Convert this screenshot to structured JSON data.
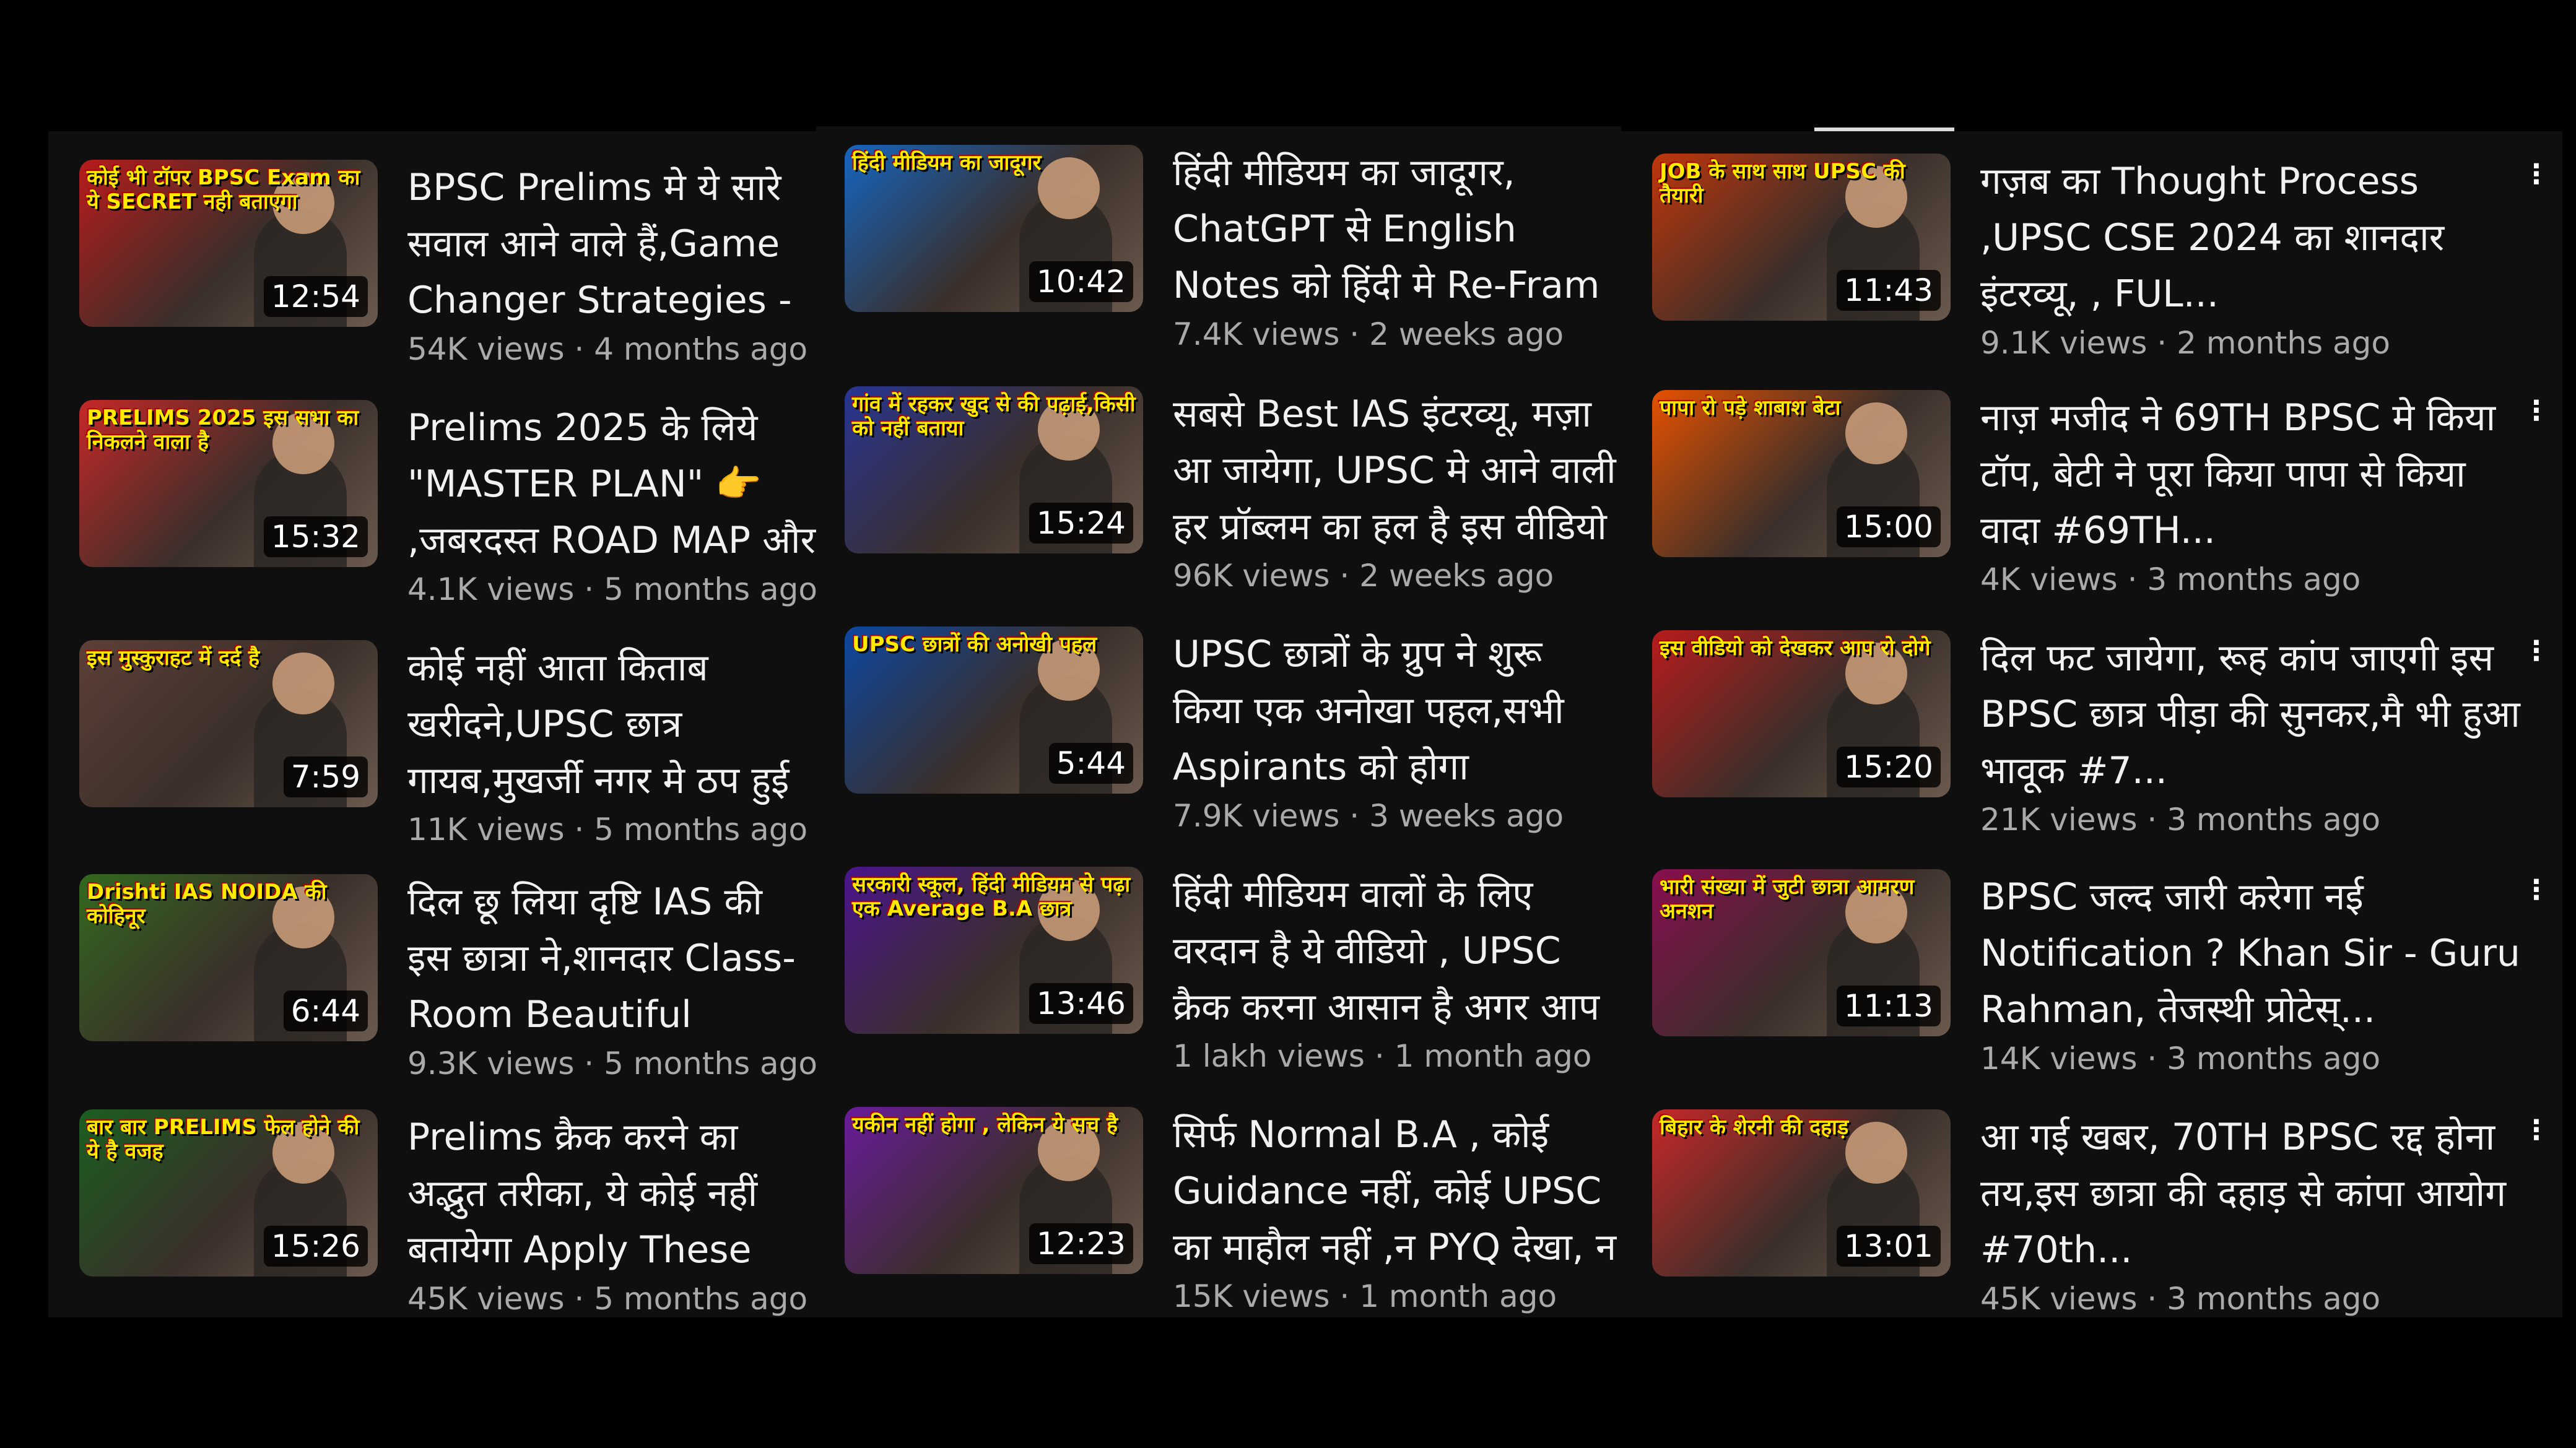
{
  "columns": [
    {
      "items": [
        {
          "title": "BPSC Prelims मे ये सारे सवाल आने वाले हैं,Game Changer Strategies -Topper's Secret",
          "views": "54K views",
          "age": "4 months ago",
          "duration": "12:54",
          "thumb_caption": "कोई भी टॉपर BPSC Exam का ये SECRET नही बताएगा",
          "accent": "#b71c1c"
        },
        {
          "title": "Prelims 2025 के लिये \"MASTER PLAN\" 👉 ,जबरदस्त ROAD MAP और Time Table",
          "views": "4.1K views",
          "age": "5 months ago",
          "duration": "15:32",
          "thumb_caption": "PRELIMS 2025 इस सभा का निकलने वाला है",
          "accent": "#c62828"
        },
        {
          "title": "कोई नहीं आता किताब खरीदने,UPSC छात्र गायब,मुखर्जी नगर मे ठप हुई सारी Business",
          "views": "11K views",
          "age": "5 months ago",
          "duration": "7:59",
          "thumb_caption": "इस मुस्कुराहट में दर्द है",
          "accent": "#5d4037"
        },
        {
          "title": "दिल छू लिया दृष्टि IAS की इस छात्रा ने,शानदार Class-Room Beautiful legacy, Noida",
          "views": "9.3K views",
          "age": "5 months ago",
          "duration": "6:44",
          "thumb_caption": "Drishti IAS NOIDA की कोहिनूर",
          "accent": "#33691e"
        },
        {
          "title": "Prelims क्रैक करने का अद्भुत तरीका, ये कोई नहीं बतायेगा Apply These Strategies",
          "views": "45K views",
          "age": "5 months ago",
          "duration": "15:26",
          "thumb_caption": "बार बार PRELIMS फेल होने की ये है वजह",
          "accent": "#1b5e20"
        }
      ]
    },
    {
      "items": [
        {
          "title": "हिंदी मीडियम का जादूगर, ChatGPT से English Notes को हिंदी मे Re-Fram करने का नया",
          "views": "7.4K views",
          "age": "2 weeks ago",
          "duration": "10:42",
          "thumb_caption": "हिंदी मीडियम का जादूगर",
          "accent": "#1565c0"
        },
        {
          "title": "सबसे Best IAS इंटरव्यू, मज़ा आ जायेगा, UPSC मे आने वाली हर प्रॉब्लम का हल है इस वीडियो में",
          "views": "96K views",
          "age": "2 weeks ago",
          "duration": "15:24",
          "thumb_caption": "गांव में रहकर खुद से की पढ़ाई,किसी को नहीं बताया",
          "accent": "#283593"
        },
        {
          "title": "UPSC छात्रों के ग्रुप ने शुरू किया एक अनोखा पहल,सभी Aspirants को होगा फ़ायदा,Toppers Notes",
          "views": "7.9K views",
          "age": "3 weeks ago",
          "duration": "5:44",
          "thumb_caption": "UPSC छात्रों की अनोखी पहल",
          "accent": "#0d47a1"
        },
        {
          "title": "हिंदी मीडियम वालों के लिए वरदान है ये वीडियो , UPSC क्रैक करना आसान है अगर आप ये करो #IAS",
          "views": "1 lakh views",
          "age": "1 month ago",
          "duration": "13:46",
          "thumb_caption": "सरकारी स्कूल, हिंदी मीडियम से पढ़ा एक Average B.A छात्र",
          "accent": "#4a148c"
        },
        {
          "title": "सिर्फ Normal B.A , कोई Guidance नहीं, कोई UPSC का माहौल नहीं ,न PYQ देखा, न फिर भी",
          "views": "15K views",
          "age": "1 month ago",
          "duration": "12:23",
          "thumb_caption": "यकीन नहीं होगा , लेकिन ये सच है",
          "accent": "#6a1b9a"
        }
      ]
    },
    {
      "items": [
        {
          "title": "गज़ब का Thought Process ,UPSC CSE 2024 का शानदार इंटरव्यू, , FUL...",
          "views": "9.1K views",
          "age": "2 months ago",
          "duration": "11:43",
          "thumb_caption": "JOB के साथ साथ UPSC की तैयारी",
          "accent": "#bf360c"
        },
        {
          "title": "नाज़ मजीद ने 69TH BPSC मे किया टॉप, बेटी ने पूरा किया पापा से किया वादा #69TH...",
          "views": "4K views",
          "age": "3 months ago",
          "duration": "15:00",
          "thumb_caption": "पापा रो पड़े शाबाश बेटा",
          "accent": "#e65100"
        },
        {
          "title": "दिल फट जायेगा, रूह कांप जाएगी इस BPSC छात्र पीड़ा की  सुनकर,मै भी हुआ भावूक #7...",
          "views": "21K views",
          "age": "3 months ago",
          "duration": "15:20",
          "thumb_caption": "इस वीडियो को देखकर आप रो दोगे",
          "accent": "#b71c1c"
        },
        {
          "title": "BPSC जल्द जारी करेगा नई Notification ? Khan Sir - Guru Rahman, तेजस्थी प्रोटेस्...",
          "views": "14K views",
          "age": "3 months ago",
          "duration": "11:13",
          "thumb_caption": "भारी संख्या में जुटी छात्रा आमरण अनशन",
          "accent": "#880e4f"
        },
        {
          "title": "आ गई खबर, 70TH BPSC रद्द होना तय,इस छात्रा की दहाड़ से कांपा आयोग #70th...",
          "views": "45K views",
          "age": "3 months ago",
          "duration": "13:01",
          "thumb_caption": "बिहार के शेरनी की दहाड़",
          "accent": "#c62828"
        }
      ]
    }
  ],
  "more_icon": "⋮",
  "separator": " · "
}
